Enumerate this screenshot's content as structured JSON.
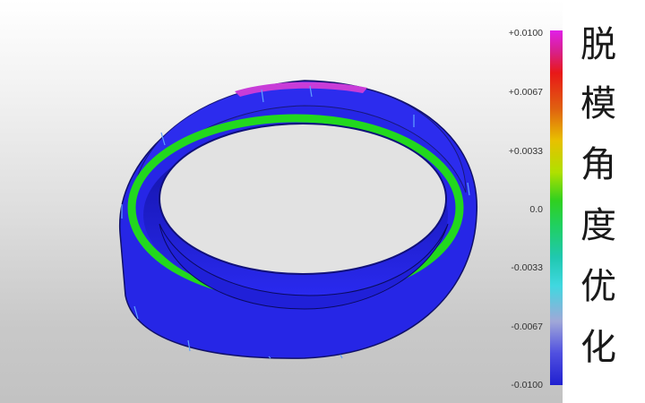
{
  "legend": {
    "ticks": [
      "+0.0100",
      "+0.0067",
      "+0.0033",
      "0.0",
      "-0.0033",
      "-0.0067",
      "-0.0100"
    ]
  },
  "side_text": {
    "chars": [
      "脱",
      "模",
      "角",
      "度",
      "优",
      "化"
    ]
  },
  "colors": {
    "ring_blue": "#2626e6",
    "band_green": "#22d81e",
    "top_magenta": "#c83cd8",
    "background_top": "#ffffff",
    "background_bottom": "#c2c2c2"
  }
}
